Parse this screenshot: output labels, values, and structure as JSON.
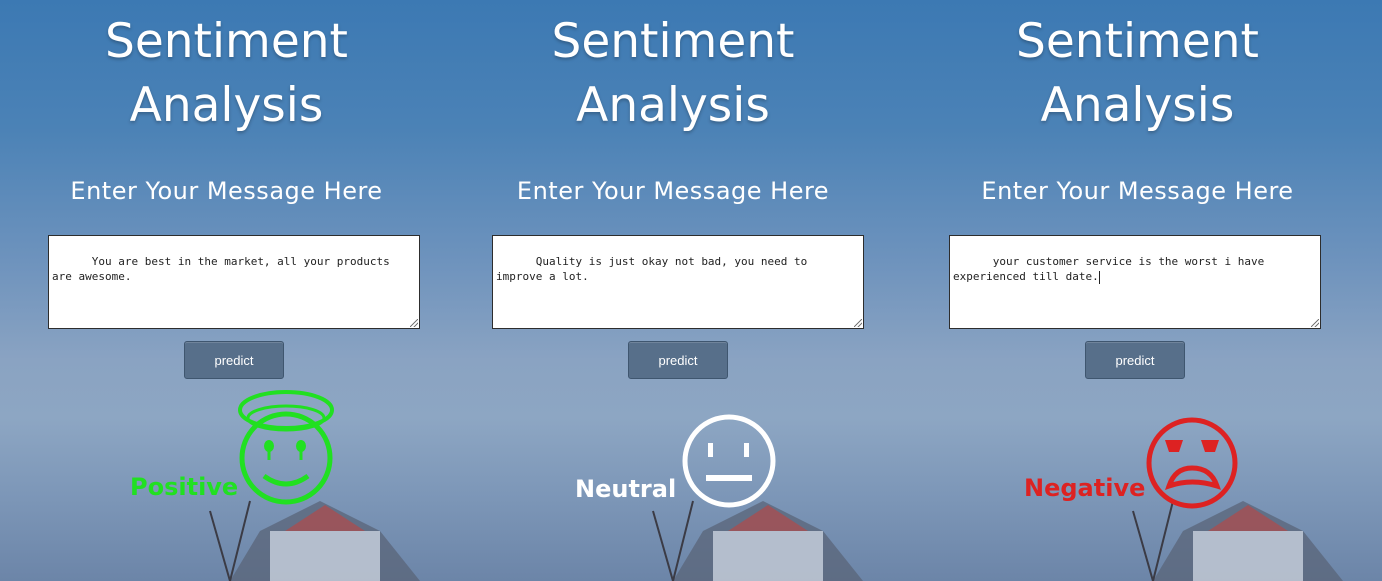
{
  "colors": {
    "positive": "#21e021",
    "neutral": "#ffffff",
    "negative": "#dd2222",
    "button_bg": "#576f8a"
  },
  "panels": [
    {
      "title_line1": "Sentiment",
      "title_line2": "Analysis",
      "subtitle": "Enter Your Message Here",
      "message": "You are best in the market, all your products are awesome.",
      "button_label": "predict",
      "result_label": "Positive",
      "result_icon": "happy-face-icon"
    },
    {
      "title_line1": "Sentiment",
      "title_line2": "Analysis",
      "subtitle": "Enter Your Message Here",
      "message": "Quality is just okay not bad, you need to improve a lot.",
      "button_label": "predict",
      "result_label": "Neutral",
      "result_icon": "neutral-face-icon"
    },
    {
      "title_line1": "Sentiment",
      "title_line2": "Analysis",
      "subtitle": "Enter Your Message Here",
      "message": "your customer service is the worst i have experienced till date.",
      "button_label": "predict",
      "result_label": "Negative",
      "result_icon": "sad-face-icon"
    }
  ]
}
